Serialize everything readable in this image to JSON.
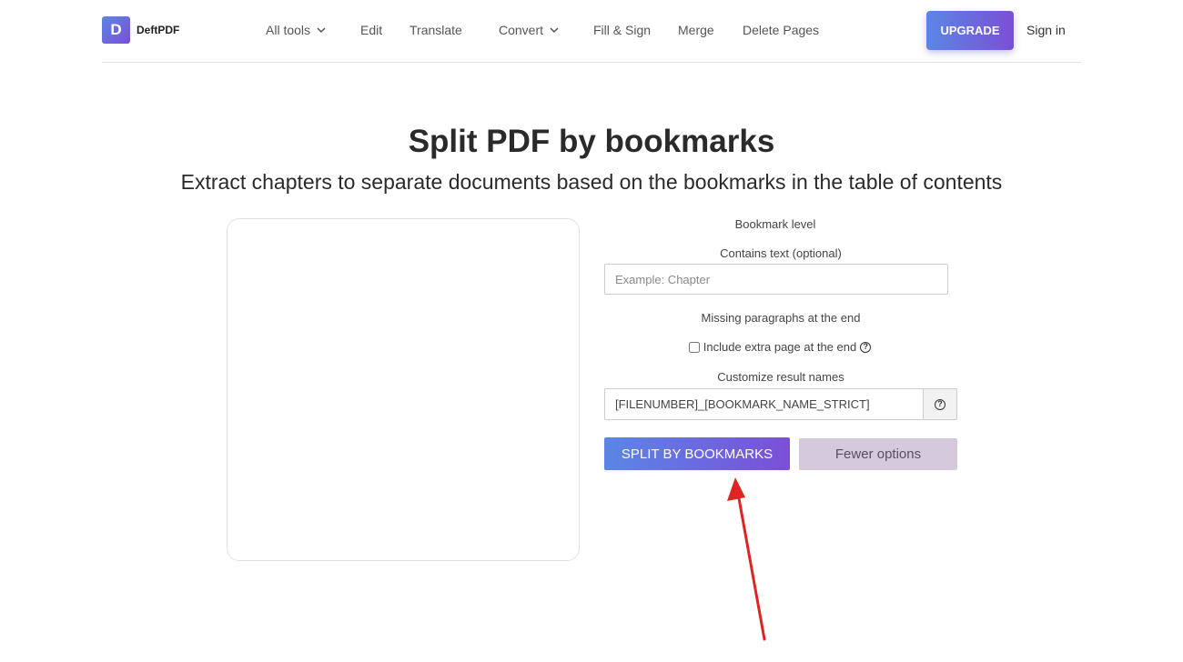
{
  "brand": {
    "logo_letter": "D",
    "name": "DeftPDF"
  },
  "nav": {
    "all_tools": "All tools",
    "edit": "Edit",
    "translate": "Translate",
    "convert": "Convert",
    "fill_sign": "Fill & Sign",
    "merge": "Merge",
    "delete_pages": "Delete Pages",
    "upgrade": "UPGRADE",
    "sign_in": "Sign in"
  },
  "page": {
    "title": "Split PDF by bookmarks",
    "subtitle": "Extract chapters to separate documents based on the bookmarks in the table of contents"
  },
  "form": {
    "bookmark_level_label": "Bookmark level",
    "contains_text_label": "Contains text (optional)",
    "contains_text_placeholder": "Example: Chapter",
    "missing_paragraphs_label": "Missing paragraphs at the end",
    "include_extra_page_label": "Include extra page at the end",
    "include_extra_page_checked": false,
    "customize_names_label": "Customize result names",
    "result_names_value": "[FILENUMBER]_[BOOKMARK_NAME_STRICT]",
    "split_button": "SPLIT BY BOOKMARKS",
    "fewer_options_button": "Fewer options"
  },
  "colors": {
    "accent_start": "#5b86e5",
    "accent_end": "#7b4fd6",
    "secondary_button": "#d5c9dc",
    "annotation_arrow": "#e02424"
  }
}
